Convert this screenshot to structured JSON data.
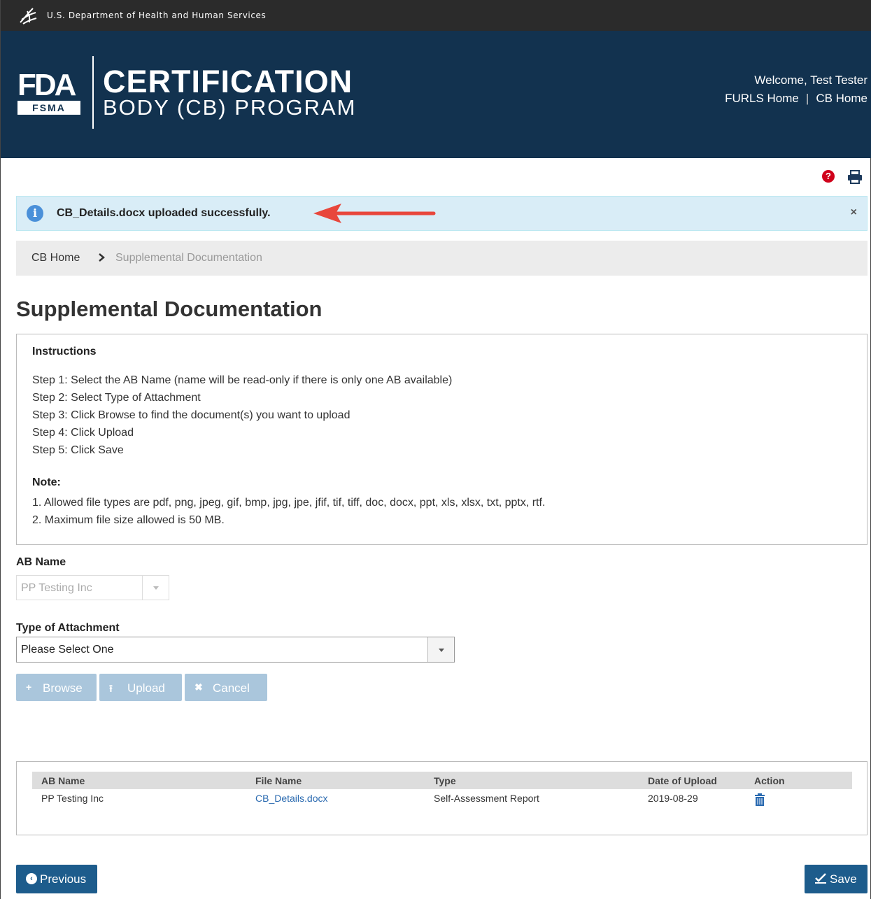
{
  "hhs_bar": {
    "text": "U.S. Department of Health and Human Services",
    "icon": "hhs-eagle-icon"
  },
  "header": {
    "logo_letters": "FDA",
    "logo_sub": "FSMA",
    "title": "CERTIFICATION",
    "subtitle": "BODY (CB) PROGRAM",
    "welcome": "Welcome, Test Tester",
    "links": [
      "FURLS Home",
      "CB Home"
    ],
    "link_separator": "|",
    "colors": {
      "background": "#12324f",
      "top_bar": "#2b2b2b"
    }
  },
  "utility": {
    "help_icon": "question-circle-icon",
    "help_glyph": "?",
    "print_icon": "print-icon"
  },
  "alert": {
    "message": "CB_Details.docx uploaded successfully.",
    "close": "×",
    "info_glyph": "i",
    "background": "#d9edf7",
    "annotation_arrow_color": "#e8473c"
  },
  "breadcrumb": {
    "home": "CB Home",
    "current": "Supplemental Documentation"
  },
  "page_title": "Supplemental Documentation",
  "instructions": {
    "title": "Instructions",
    "steps": [
      "Step 1: Select the AB Name (name will be read-only if there is only one AB available)",
      "Step 2: Select Type of Attachment",
      "Step 3: Click Browse to find the document(s) you want to upload",
      "Step 4: Click Upload",
      "Step 5: Click Save"
    ],
    "note_title": "Note:",
    "notes": [
      "1. Allowed file types are pdf, png, jpeg, gif, bmp, jpg, jpe, jfif, tif, tiff, doc, docx, ppt, xls, xlsx, txt, pptx, rtf.",
      "2. Maximum file size allowed is 50 MB."
    ]
  },
  "form": {
    "ab_name_label": "AB Name",
    "ab_name_value": "PP Testing Inc",
    "type_label": "Type of Attachment",
    "type_value": "Please Select One",
    "buttons": {
      "browse": "Browse",
      "upload": "Upload",
      "cancel": "Cancel",
      "browse_glyph": "+",
      "upload_glyph": "⭱",
      "cancel_glyph": "✖"
    }
  },
  "table": {
    "headers": [
      "AB Name",
      "File Name",
      "Type",
      "Date of Upload",
      "Action"
    ],
    "rows": [
      {
        "ab_name": "PP Testing Inc",
        "file_name": "CB_Details.docx",
        "type": "Self-Assessment Report",
        "date": "2019-08-29",
        "action_icon": "trash-icon"
      }
    ]
  },
  "footer": {
    "previous": "Previous",
    "previous_glyph": "‹",
    "save": "Save"
  },
  "colors": {
    "primary": "#1d5c8c",
    "disabled_button": "#aac6dc",
    "link": "#2a6ab0",
    "help_icon": "#d0021b"
  }
}
